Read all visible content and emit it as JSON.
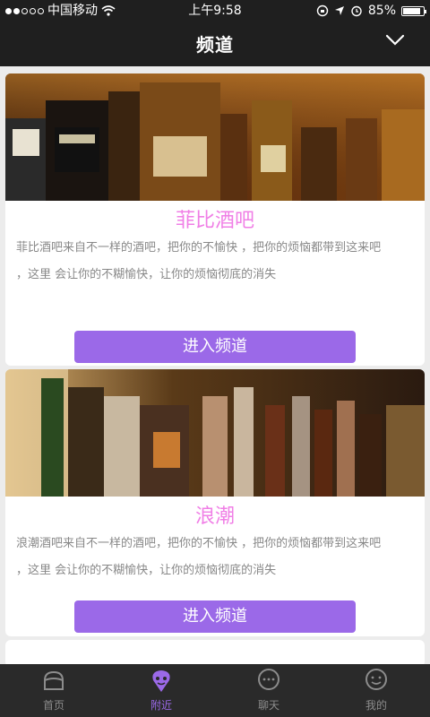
{
  "status": {
    "carrier": "中国移动",
    "time": "上午9:58",
    "battery": "85%",
    "battery_level": 0.85
  },
  "header": {
    "title": "频道",
    "dropdown_icon": "chevron-down-icon"
  },
  "channels": [
    {
      "title": "菲比酒吧",
      "desc_line1": "菲比酒吧来自不一样的酒吧，把你的不愉快 ，把你的烦恼都带到这来吧",
      "desc_line2": "，这里 会让你的不糊愉快，让你的烦恼彻底的消失",
      "button": "进入频道"
    },
    {
      "title": "浪潮",
      "desc_line1": "浪潮酒吧来自不一样的酒吧，把你的不愉快 ，把你的烦恼都带到这来吧",
      "desc_line2": "，这里 会让你的不糊愉快，让你的烦恼彻底的消失",
      "button": "进入频道"
    }
  ],
  "tabs": [
    {
      "label": "首页",
      "icon": "home-icon"
    },
    {
      "label": "附近",
      "icon": "location-pin-icon",
      "active": true
    },
    {
      "label": "聊天",
      "icon": "chat-bubble-icon"
    },
    {
      "label": "我的",
      "icon": "profile-bubble-icon"
    }
  ],
  "colors": {
    "accent": "#9b69e8",
    "title": "#f07fe6",
    "header_bg": "#1f1f1f"
  }
}
